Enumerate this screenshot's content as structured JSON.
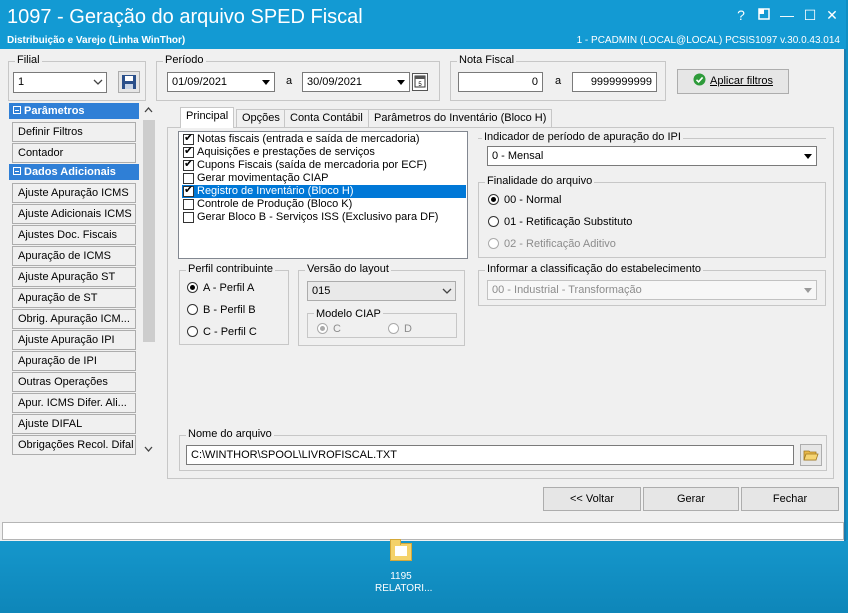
{
  "window": {
    "title": "1097 - Geração do arquivo SPED Fiscal",
    "subtitle": "Distribuição e Varejo (Linha WinThor)",
    "status_info": "1 - PCADMIN (LOCAL@LOCAL)   PCSIS1097  v.30.0.43.014",
    "controls": {
      "help": "?",
      "minimize": "—",
      "maximize": "☐",
      "close": "✕"
    }
  },
  "filters": {
    "filial_label": "Filial",
    "filial_value": "1",
    "periodo_label": "Período",
    "date_from": "01/09/2021",
    "date_separator": "a",
    "date_to": "30/09/2021",
    "nota_label": "Nota Fiscal",
    "nota_from": "0",
    "nota_separator": "a",
    "nota_to": "9999999999",
    "apply_label": "Aplicar filtros"
  },
  "sidebar": {
    "section1": "Parâmetros",
    "section1_items": [
      "Definir Filtros",
      "Contador"
    ],
    "section2": "Dados Adicionais",
    "section2_items": [
      "Ajuste Apuração ICMS",
      "Ajuste Adicionais ICMS",
      "Ajustes Doc. Fiscais",
      "Apuração de ICMS",
      "Ajuste Apuração ST",
      "Apuração de ST",
      "Obrig. Apuração ICM...",
      "Ajuste Apuração IPI",
      "Apuração de IPI",
      "Outras Operações",
      "Apur. ICMS Difer. Ali...",
      "Ajuste DIFAL",
      "Obrigações Recol. Difal"
    ]
  },
  "tabs": [
    "Principal",
    "Opções",
    "Conta Contábil",
    "Parâmetros do Inventário (Bloco H)"
  ],
  "checklist": [
    {
      "label": "Notas fiscais (entrada e saída de mercadoria)",
      "checked": true,
      "selected": false
    },
    {
      "label": "Aquisições e prestações de serviços",
      "checked": true,
      "selected": false
    },
    {
      "label": "Cupons Fiscais (saída de mercadoria por ECF)",
      "checked": true,
      "selected": false
    },
    {
      "label": "Gerar movimentação CIAP",
      "checked": false,
      "selected": false
    },
    {
      "label": "Registro de Inventário (Bloco H)",
      "checked": true,
      "selected": true
    },
    {
      "label": "Controle de Produção (Bloco K)",
      "checked": false,
      "selected": false
    },
    {
      "label": "Gerar Bloco B - Serviços ISS (Exclusivo para DF)",
      "checked": false,
      "selected": false
    }
  ],
  "ipi": {
    "label": "Indicador de período de apuração do IPI",
    "value": "0 - Mensal"
  },
  "finalidade": {
    "label": "Finalidade do arquivo",
    "options": [
      {
        "label": "00 - Normal",
        "selected": true,
        "disabled": false
      },
      {
        "label": "01 - Retificação Substituto",
        "selected": false,
        "disabled": false
      },
      {
        "label": "02 - Retificação Aditivo",
        "selected": false,
        "disabled": true
      }
    ]
  },
  "perfil": {
    "label": "Perfil contribuinte",
    "options": [
      {
        "label": "A - Perfil A",
        "selected": true
      },
      {
        "label": "B - Perfil B",
        "selected": false
      },
      {
        "label": "C - Perfil C",
        "selected": false
      }
    ]
  },
  "layout": {
    "label": "Versão do layout",
    "value": "015"
  },
  "ciap": {
    "label": "Modelo CIAP",
    "option_c": "C",
    "option_d": "D"
  },
  "classificacao": {
    "label": "Informar a classificação do estabelecimento",
    "value": "00 - Industrial - Transformação"
  },
  "arquivo": {
    "label": "Nome do arquivo",
    "value": "C:\\WINTHOR\\SPOOL\\LIVROFISCAL.TXT"
  },
  "actions": {
    "back": "<< Voltar",
    "generate": "Gerar",
    "close": "Fechar"
  },
  "desktop_icon": {
    "line1": "1195",
    "line2": "RELATORI..."
  }
}
